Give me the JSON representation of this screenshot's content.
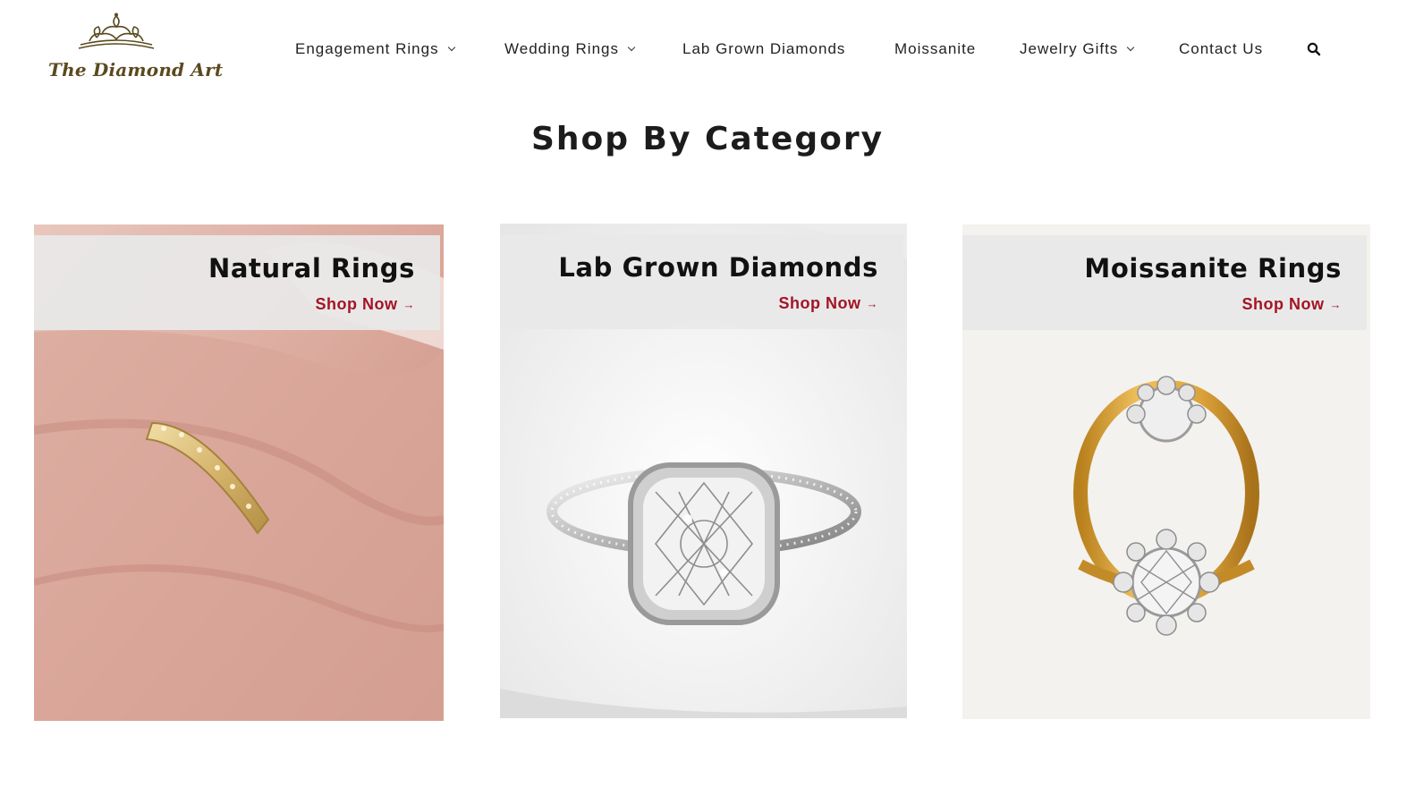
{
  "brand": {
    "name": "The Diamond Art",
    "color": "#5a4a1f"
  },
  "nav": {
    "items": [
      {
        "label": "Engagement Rings",
        "dropdown": true
      },
      {
        "label": "Wedding Rings",
        "dropdown": true
      },
      {
        "label": "Lab Grown Diamonds",
        "dropdown": false
      },
      {
        "label": "Moissanite",
        "dropdown": false
      },
      {
        "label": "Jewelry Gifts",
        "dropdown": true
      },
      {
        "label": "Contact Us",
        "dropdown": false
      }
    ],
    "search_icon": "search-icon"
  },
  "section": {
    "title": "Shop By Category"
  },
  "categories": [
    {
      "title": "Natural Rings",
      "link": "Shop Now",
      "image": "gold-link-band-on-finger"
    },
    {
      "title": "Lab Grown Diamonds",
      "link": "Shop Now",
      "image": "cushion-halo-white-gold-ring"
    },
    {
      "title": "Moissanite Rings",
      "link": "Shop Now",
      "image": "yellow-gold-starburst-ring"
    }
  ],
  "colors": {
    "link": "#a31424",
    "banner": "#e8e8e8"
  }
}
